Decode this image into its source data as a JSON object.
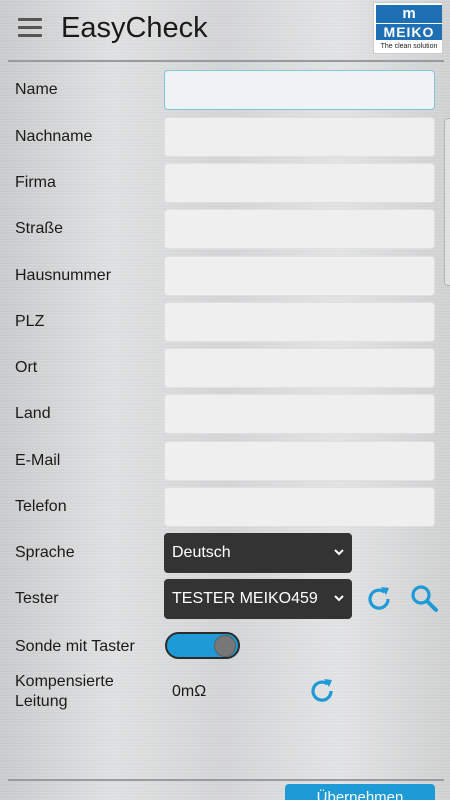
{
  "app": {
    "title": "EasyCheck",
    "logo": {
      "brand": "MEIKO",
      "tagline": "The clean solution"
    }
  },
  "form": {
    "fields": [
      {
        "label": "Name",
        "value": ""
      },
      {
        "label": "Nachname",
        "value": ""
      },
      {
        "label": "Firma",
        "value": ""
      },
      {
        "label": "Straße",
        "value": ""
      },
      {
        "label": "Hausnummer",
        "value": ""
      },
      {
        "label": "PLZ",
        "value": ""
      },
      {
        "label": "Ort",
        "value": ""
      },
      {
        "label": "Land",
        "value": ""
      },
      {
        "label": "E-Mail",
        "value": ""
      },
      {
        "label": "Telefon",
        "value": ""
      }
    ],
    "language": {
      "label": "Sprache",
      "value": "Deutsch"
    },
    "tester": {
      "label": "Tester",
      "value": "TESTER MEIKO459"
    },
    "probe": {
      "label": "Sonde mit Taster",
      "enabled": true
    },
    "compensated": {
      "label_line1": "Kompensierte",
      "label_line2": "Leitung",
      "value": "0mΩ"
    }
  },
  "footer": {
    "button_label": "Übernehmen"
  },
  "colors": {
    "accent": "#1e9ad6",
    "select_bg": "#333333",
    "focus_border": "#7fc4dd"
  }
}
